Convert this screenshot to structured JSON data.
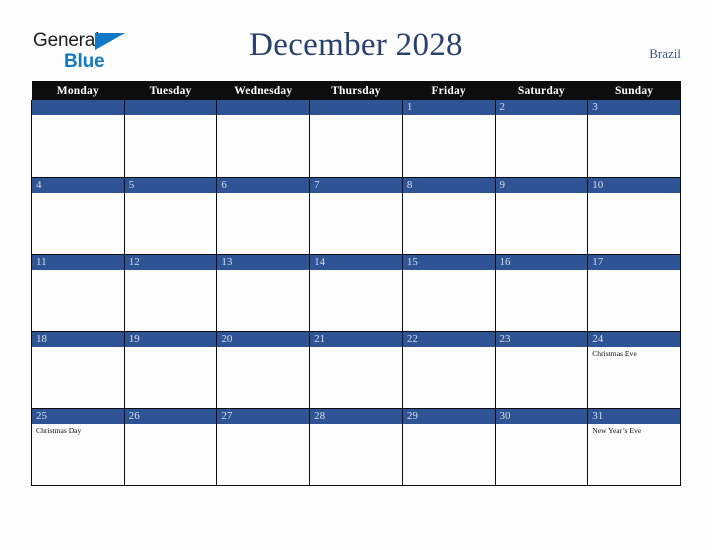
{
  "brand": {
    "name_top": "General",
    "name_bottom": "Blue",
    "triangle_color": "#1277c4"
  },
  "header": {
    "title": "December 2028",
    "country": "Brazil",
    "title_color": "#27406d"
  },
  "calendar": {
    "weekday_headers": [
      "Monday",
      "Tuesday",
      "Wednesday",
      "Thursday",
      "Friday",
      "Saturday",
      "Sunday"
    ],
    "band_color": "#2f5496",
    "header_bg": "#0d0d0d",
    "weeks": [
      [
        {
          "day": "",
          "events": []
        },
        {
          "day": "",
          "events": []
        },
        {
          "day": "",
          "events": []
        },
        {
          "day": "",
          "events": []
        },
        {
          "day": "1",
          "events": []
        },
        {
          "day": "2",
          "events": []
        },
        {
          "day": "3",
          "events": []
        }
      ],
      [
        {
          "day": "4",
          "events": []
        },
        {
          "day": "5",
          "events": []
        },
        {
          "day": "6",
          "events": []
        },
        {
          "day": "7",
          "events": []
        },
        {
          "day": "8",
          "events": []
        },
        {
          "day": "9",
          "events": []
        },
        {
          "day": "10",
          "events": []
        }
      ],
      [
        {
          "day": "11",
          "events": []
        },
        {
          "day": "12",
          "events": []
        },
        {
          "day": "13",
          "events": []
        },
        {
          "day": "14",
          "events": []
        },
        {
          "day": "15",
          "events": []
        },
        {
          "day": "16",
          "events": []
        },
        {
          "day": "17",
          "events": []
        }
      ],
      [
        {
          "day": "18",
          "events": []
        },
        {
          "day": "19",
          "events": []
        },
        {
          "day": "20",
          "events": []
        },
        {
          "day": "21",
          "events": []
        },
        {
          "day": "22",
          "events": []
        },
        {
          "day": "23",
          "events": []
        },
        {
          "day": "24",
          "events": [
            "Christmas Eve"
          ]
        }
      ],
      [
        {
          "day": "25",
          "events": [
            "Christmas Day"
          ]
        },
        {
          "day": "26",
          "events": []
        },
        {
          "day": "27",
          "events": []
        },
        {
          "day": "28",
          "events": []
        },
        {
          "day": "29",
          "events": []
        },
        {
          "day": "30",
          "events": []
        },
        {
          "day": "31",
          "events": [
            "New Year’s Eve"
          ]
        }
      ]
    ]
  }
}
